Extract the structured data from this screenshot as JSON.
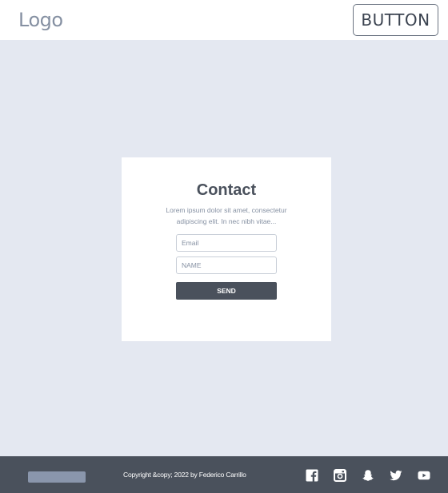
{
  "header": {
    "logo": "Logo",
    "button_label": "BUTTON"
  },
  "contact": {
    "title": "Contact",
    "description": "Lorem ipsum dolor sit amet, consectetur adipiscing elit. In nec nibh vitae...",
    "email_placeholder": "Email",
    "name_placeholder": "NAME",
    "send_label": "SEND"
  },
  "footer": {
    "copyright": "Copyright &copy; 2022 by Federico Carrillo",
    "socials": [
      "facebook-icon",
      "instagram-icon",
      "snapchat-icon",
      "twitter-icon",
      "youtube-icon"
    ]
  },
  "colors": {
    "page_bg": "#e4e8f1",
    "dark": "#4a515c",
    "muted": "#8590a2",
    "footer_pill": "#8a96ac"
  }
}
